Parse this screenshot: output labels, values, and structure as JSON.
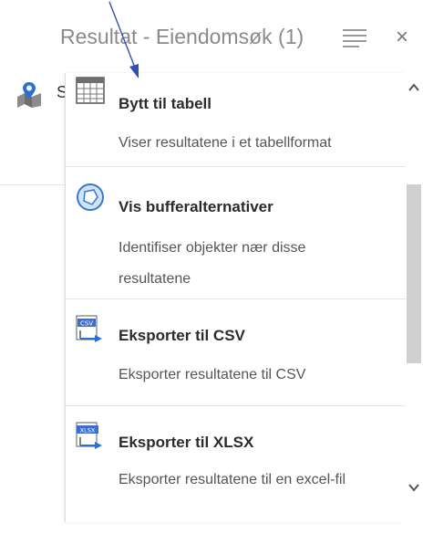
{
  "header": {
    "title": "Resultat - Eiendomsøk (1)",
    "menu_icon": "hamburger-menu-icon",
    "close_label": "×"
  },
  "behind": {
    "row_letter": "S",
    "row_icon": "map-pin-icon"
  },
  "menu": {
    "items": [
      {
        "icon": "table-icon",
        "label": "Bytt til tabell",
        "description": "Viser resultatene i et tabellformat"
      },
      {
        "icon": "buffer-icon",
        "label": "Vis bufferalternativer",
        "description": "Identifiser objekter nær disse resultatene"
      },
      {
        "icon": "csv-export-icon",
        "label": "Eksporter til CSV",
        "description": "Eksporter resultatene til CSV"
      },
      {
        "icon": "xlsx-export-icon",
        "label": "Eksporter til XLSX",
        "description": "Eksporter resultatene til en excel-fil"
      }
    ]
  },
  "colors": {
    "accent_blue": "#3a6fd1",
    "annotation_arrow": "#2f4fb5",
    "title_gray": "#8a8a8a"
  }
}
